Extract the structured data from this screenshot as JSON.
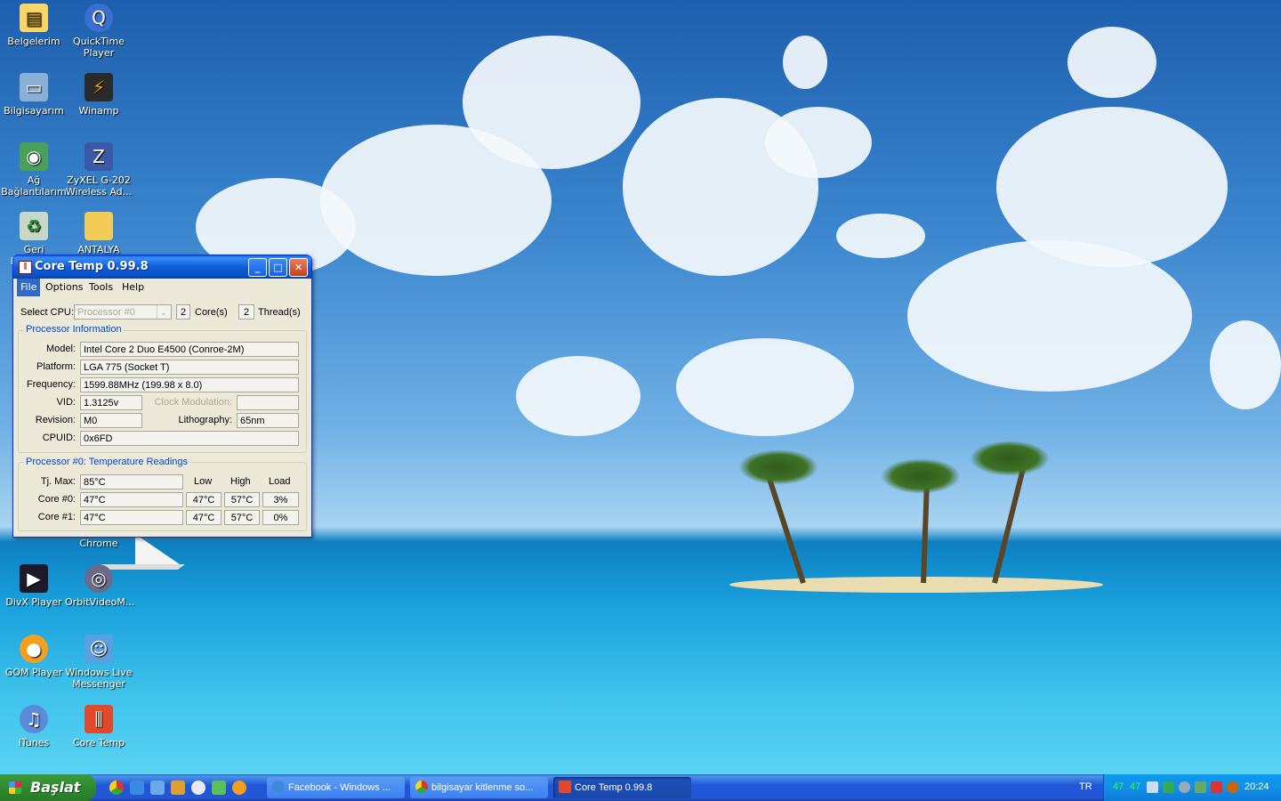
{
  "desktop_icons": [
    {
      "label": "Belgelerim",
      "icon": "folder-documents-icon"
    },
    {
      "label": "QuickTime Player",
      "icon": "quicktime-icon"
    },
    {
      "label": "Bilgisayarım",
      "icon": "computer-icon"
    },
    {
      "label": "Winamp",
      "icon": "winamp-icon"
    },
    {
      "label": "Ağ Bağlantılarım",
      "icon": "network-icon"
    },
    {
      "label": "ZyXEL G-202 Wireless Ad...",
      "icon": "zyxel-icon"
    },
    {
      "label": "Geri Dönüşüm",
      "icon": "recycle-bin-icon"
    },
    {
      "label": "ANTALYA",
      "icon": "folder-icon"
    },
    {
      "label": "Chrome",
      "icon": "chrome-icon"
    },
    {
      "label": "DivX Player",
      "icon": "divx-icon"
    },
    {
      "label": "OrbitVideoM...",
      "icon": "orbit-video-icon"
    },
    {
      "label": "GOM Player",
      "icon": "gom-player-icon"
    },
    {
      "label": "Windows Live Messenger",
      "icon": "messenger-icon"
    },
    {
      "label": "iTunes",
      "icon": "itunes-icon"
    },
    {
      "label": "Core Temp",
      "icon": "core-temp-icon"
    }
  ],
  "window": {
    "title": "Core Temp 0.99.8",
    "menu": [
      "File",
      "Options",
      "Tools",
      "Help"
    ],
    "select_cpu_label": "Select CPU:",
    "processor_value": "Processor #0",
    "cores_count": "2",
    "cores_label": "Core(s)",
    "threads_count": "2",
    "threads_label": "Thread(s)",
    "proc_info_title": "Processor Information",
    "model_label": "Model:",
    "model_value": "Intel Core 2 Duo E4500 (Conroe-2M)",
    "platform_label": "Platform:",
    "platform_value": "LGA 775 (Socket T)",
    "frequency_label": "Frequency:",
    "frequency_value": "1599.88MHz (199.98 x 8.0)",
    "vid_label": "VID:",
    "vid_value": "1.3125v",
    "clock_mod_label": "Clock Modulation:",
    "clock_mod_value": "",
    "revision_label": "Revision:",
    "revision_value": "M0",
    "lithography_label": "Lithography:",
    "lithography_value": "65nm",
    "cpuid_label": "CPUID:",
    "cpuid_value": "0x6FD",
    "temp_title": "Processor #0: Temperature Readings",
    "tjmax_label": "Tj. Max:",
    "tjmax_value": "85°C",
    "col_low": "Low",
    "col_high": "High",
    "col_load": "Load",
    "cores": [
      {
        "label": "Core #0:",
        "temp": "47°C",
        "low": "47°C",
        "high": "57°C",
        "load": "3%"
      },
      {
        "label": "Core #1:",
        "temp": "47°C",
        "low": "47°C",
        "high": "57°C",
        "load": "0%"
      }
    ]
  },
  "taskbar": {
    "start_label": "Başlat",
    "quick_launch": [
      "chrome-icon",
      "ie-icon",
      "media-icon",
      "winamp-icon",
      "media-player-icon",
      "messenger-icon",
      "gom-icon"
    ],
    "tasks": [
      {
        "label": "Facebook - Windows ...",
        "icon": "ie-icon",
        "active": false
      },
      {
        "label": "bilgisayar kitlenme so...",
        "icon": "chrome-icon",
        "active": false
      },
      {
        "label": "Core Temp 0.99.8",
        "icon": "core-temp-icon",
        "active": true
      }
    ],
    "language": "TR",
    "tray_temp1": "47",
    "tray_temp2": "47",
    "clock": "20:24"
  }
}
